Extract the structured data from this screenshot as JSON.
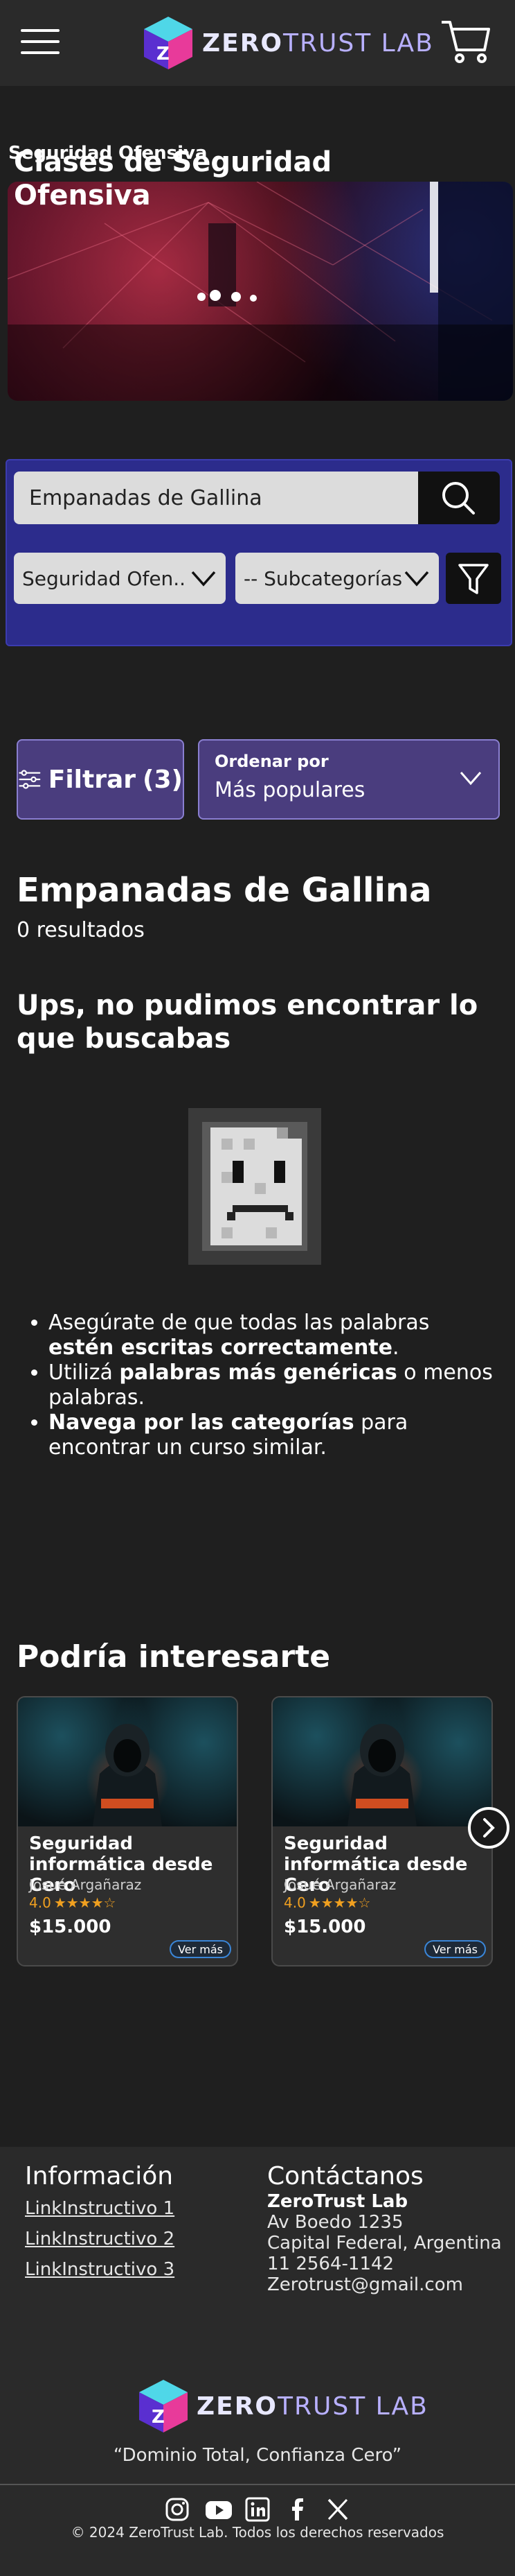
{
  "header": {
    "logo_zero": "ZERO",
    "logo_rest": "TRUST LAB",
    "menu_icon": "hamburger-icon",
    "cart_icon": "cart-icon"
  },
  "breadcrumb": "Seguridad Ofensiva",
  "hero": {
    "title": "Clases de Seguridad Ofensiva"
  },
  "search": {
    "value": "Empanadas de Gallina",
    "category": "Seguridad Ofen..",
    "subcategory": "-- Subcategorías"
  },
  "filters": {
    "filter_label": "Filtrar",
    "filter_count": "(3)",
    "sort_label": "Ordenar por",
    "sort_value": "Más populares"
  },
  "results": {
    "query": "Empanadas de Gallina",
    "count": "0 resultados",
    "empty_title": "Ups, no pudimos encontrar lo que buscabas",
    "tip1_a": "Asegúrate de que todas las palabras ",
    "tip1_b": "estén escritas correctamente",
    "tip1_c": ".",
    "tip2_a": "Utilizá ",
    "tip2_b": "palabras más genéricas",
    "tip2_c": " o menos palabras.",
    "tip3_a": "Navega por las categorías",
    "tip3_b": " para encontrar un curso similar."
  },
  "recommendations": {
    "title": "Podría interesarte",
    "cards": [
      {
        "title": "Seguridad informática desde Cero",
        "author": "Josué Argañaraz",
        "rating": "4.0",
        "stars": "★★★★☆",
        "price": "$15.000",
        "more": "Ver más"
      },
      {
        "title": "Seguridad informática desde Cero",
        "author": "Josué Argañaraz",
        "rating": "4.0",
        "stars": "★★★★☆",
        "price": "$15.000",
        "more": "Ver más"
      }
    ]
  },
  "footer": {
    "info_title": "Información",
    "links": [
      "LinkInstructivo 1",
      "LinkInstructivo 2",
      "LinkInstructivo 3"
    ],
    "contact_title": "Contáctanos",
    "company": "ZeroTrust Lab",
    "address1": "Av Boedo 1235",
    "address2": "Capital Federal, Argentina",
    "phone": "11 2564-1142",
    "email": "Zerotrust@gmail.com",
    "motto": "“Dominio Total, Confianza Cero”",
    "copyright": "© 2024 ZeroTrust Lab. Todos los derechos reservados"
  },
  "colors": {
    "background": "#1f1f1f",
    "panel": "#2c2c8c",
    "filter_bg": "#4a3d7e",
    "accent_star": "#f0a020",
    "ver_mas_border": "#3a86d8"
  }
}
